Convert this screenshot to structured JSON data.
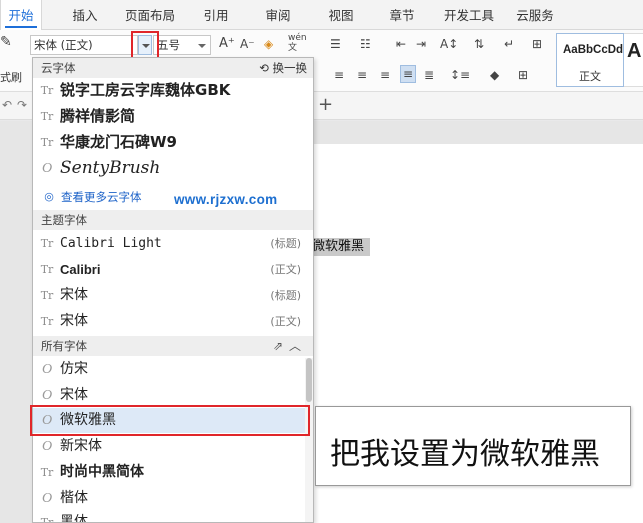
{
  "menubar": {
    "tabs": [
      "开始",
      "插入",
      "页面布局",
      "引用",
      "审阅",
      "视图",
      "章节",
      "开发工具",
      "云服务"
    ]
  },
  "ribbon": {
    "font_value": "宋体 (正文)",
    "size_value": "五号",
    "style_sample": "AaBbCcDd",
    "style_name": "正文",
    "style_sample2": "A",
    "left_label": "式刷"
  },
  "document": {
    "selected_text": "微软雅黑"
  },
  "font_panel": {
    "cloud": {
      "header": "云字体",
      "action": "换一换",
      "fonts": [
        "锐字工房云字库魏体GBK",
        "腾祥倩影简",
        "华康龙门石碑W9",
        "SentyBrush"
      ],
      "more_link": "查看更多云字体"
    },
    "theme": {
      "header": "主题字体",
      "fonts": [
        {
          "name": "Calibri Light",
          "tag": "(标题)"
        },
        {
          "name": "Calibri",
          "tag": "(正文)"
        },
        {
          "name": "宋体",
          "tag": "(标题)"
        },
        {
          "name": "宋体",
          "tag": "(正文)"
        }
      ]
    },
    "all": {
      "header": "所有字体",
      "fonts": [
        "仿宋",
        "宋体",
        "微软雅黑",
        "新宋体",
        "时尚中黑简体",
        "楷体",
        "黑体"
      ]
    }
  },
  "watermark": "www.rjzxw.com",
  "callout": "把我设置为微软雅黑",
  "colors": {
    "accent": "#1e6fd9",
    "highlight_red": "#e0262a",
    "selected_row": "#dde9f7"
  }
}
